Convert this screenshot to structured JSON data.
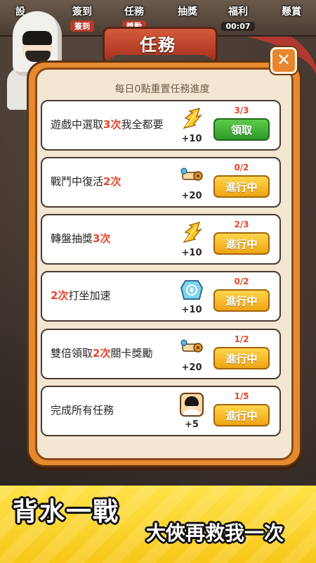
{
  "top_nav": {
    "items": [
      {
        "label": "設",
        "sub": ""
      },
      {
        "label": "簽到",
        "sub": "簽到"
      },
      {
        "label": "任務",
        "sub": "獎勵"
      },
      {
        "label": "抽獎",
        "sub": ""
      },
      {
        "label": "福利",
        "sub": "00:07"
      },
      {
        "label": "懸賞",
        "sub": ""
      }
    ]
  },
  "modal": {
    "title": "任務",
    "close_label": "✕",
    "reset_note": "每日0點重置任務進度"
  },
  "tasks": [
    {
      "pre": "遊戲中選取",
      "hl": "3次",
      "post": "我全都要",
      "reward_icon": "gold-feather-icon",
      "reward": "+10",
      "progress": "3/3",
      "button": "領取",
      "state": "claim"
    },
    {
      "pre": "戰鬥中復活",
      "hl": "2次",
      "post": "",
      "reward_icon": "scroll-icon",
      "reward": "+20",
      "progress": "0/2",
      "button": "進行中",
      "state": "in-progress"
    },
    {
      "pre": "轉盤抽獎",
      "hl": "3次",
      "post": "",
      "reward_icon": "gold-feather-icon",
      "reward": "+10",
      "progress": "2/3",
      "button": "進行中",
      "state": "in-progress"
    },
    {
      "pre": "",
      "hl": "2次",
      "post": "打坐加速",
      "reward_icon": "blue-gem-icon",
      "reward": "+10",
      "progress": "0/2",
      "button": "進行中",
      "state": "in-progress"
    },
    {
      "pre": "雙倍領取",
      "hl": "2次",
      "post": "關卡獎勵",
      "reward_icon": "scroll-icon",
      "reward": "+20",
      "progress": "1/2",
      "button": "進行中",
      "state": "in-progress"
    },
    {
      "pre": "完成所有任務",
      "hl": "",
      "post": "",
      "reward_icon": "character-avatar-icon",
      "reward": "+5",
      "progress": "1/5",
      "button": "進行中",
      "state": "in-progress"
    }
  ],
  "banner": {
    "main": "背水一戰",
    "sub": "大俠再救我一次"
  },
  "colors": {
    "highlight": "#e5462b",
    "claim_button": "#3fae35",
    "progress_button": "#f7b321",
    "panel": "#e78a2e"
  }
}
